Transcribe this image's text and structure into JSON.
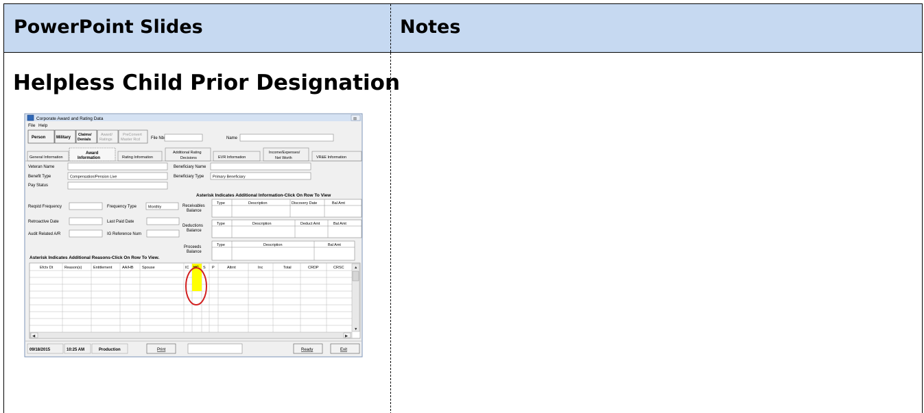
{
  "header": {
    "left": "PowerPoint Slides",
    "right": "Notes"
  },
  "slide": {
    "title": "Helpless Child Prior Designation"
  },
  "app": {
    "window_title": "Corporate Award and Rating Data",
    "close": "⊠",
    "menu": [
      "File",
      "Help"
    ],
    "toolbar": {
      "person": "Person",
      "military": "Military",
      "claims": "Claims/ Denials",
      "award": "Award/ Ratings",
      "preconvert": "PreConvert Master Rcd",
      "file_nbr_label": "File Nbr",
      "name_label": "Name"
    },
    "tabs": [
      "General Information",
      "Award Information",
      "Rating Information",
      "Additional Rating Decisions",
      "EVR Information",
      "Income/Expenses/ Net Worth",
      "VR&E Information"
    ],
    "fields": {
      "veteran_name": "Veteran Name",
      "benefit_type": "Benefit Type",
      "benefit_type_value": "Compensation/Pension Live",
      "pay_status": "Pay Status",
      "beneficiary_name": "Beneficiary Name",
      "beneficiary_type": "Beneficiary Type",
      "beneficiary_type_value": "Primary Beneficiary",
      "reqstd_frequency": "Reqstd Frequency",
      "frequency_type": "Frequency Type",
      "frequency_type_value": "Monthly",
      "retroactive_date": "Retroactive Date",
      "last_paid_date": "Last Paid Date",
      "audit_related": "Audit Related A/R",
      "ig_reference": "IG Reference Num"
    },
    "asterisk_info": "Asterisk Indicates Additional Information-Click On Row To View",
    "receivables": {
      "label": "Receivables Balance",
      "cols": [
        "Type",
        "Description",
        "Discovery Date",
        "Bal Amt"
      ]
    },
    "deductions": {
      "label": "Deductions Balance",
      "cols": [
        "Type",
        "Description",
        "Deduct Amt",
        "Bal Amt"
      ]
    },
    "proceeds": {
      "label": "Proceeds Balance",
      "cols": [
        "Type",
        "Description",
        "Bal Amt"
      ]
    },
    "asterisk_reasons": "Asterisk Indicates Additional Reasons-Click On Row To View.",
    "grid_cols": [
      "Efctv Dt",
      "Reason(s)",
      "Entitlement",
      "AA/HB",
      "Spouse",
      "IC",
      "HC",
      "S",
      "P",
      "Altrnt",
      "Inc",
      "Total",
      "CRDP",
      "CRSC"
    ],
    "status": {
      "date": "09/18/2015",
      "time": "10:25 AM",
      "env": "Production",
      "print": "Print",
      "ready": "Ready",
      "exit": "Exit"
    },
    "highlight_color": "#ffff00",
    "circle_color": "#d21f1f"
  }
}
